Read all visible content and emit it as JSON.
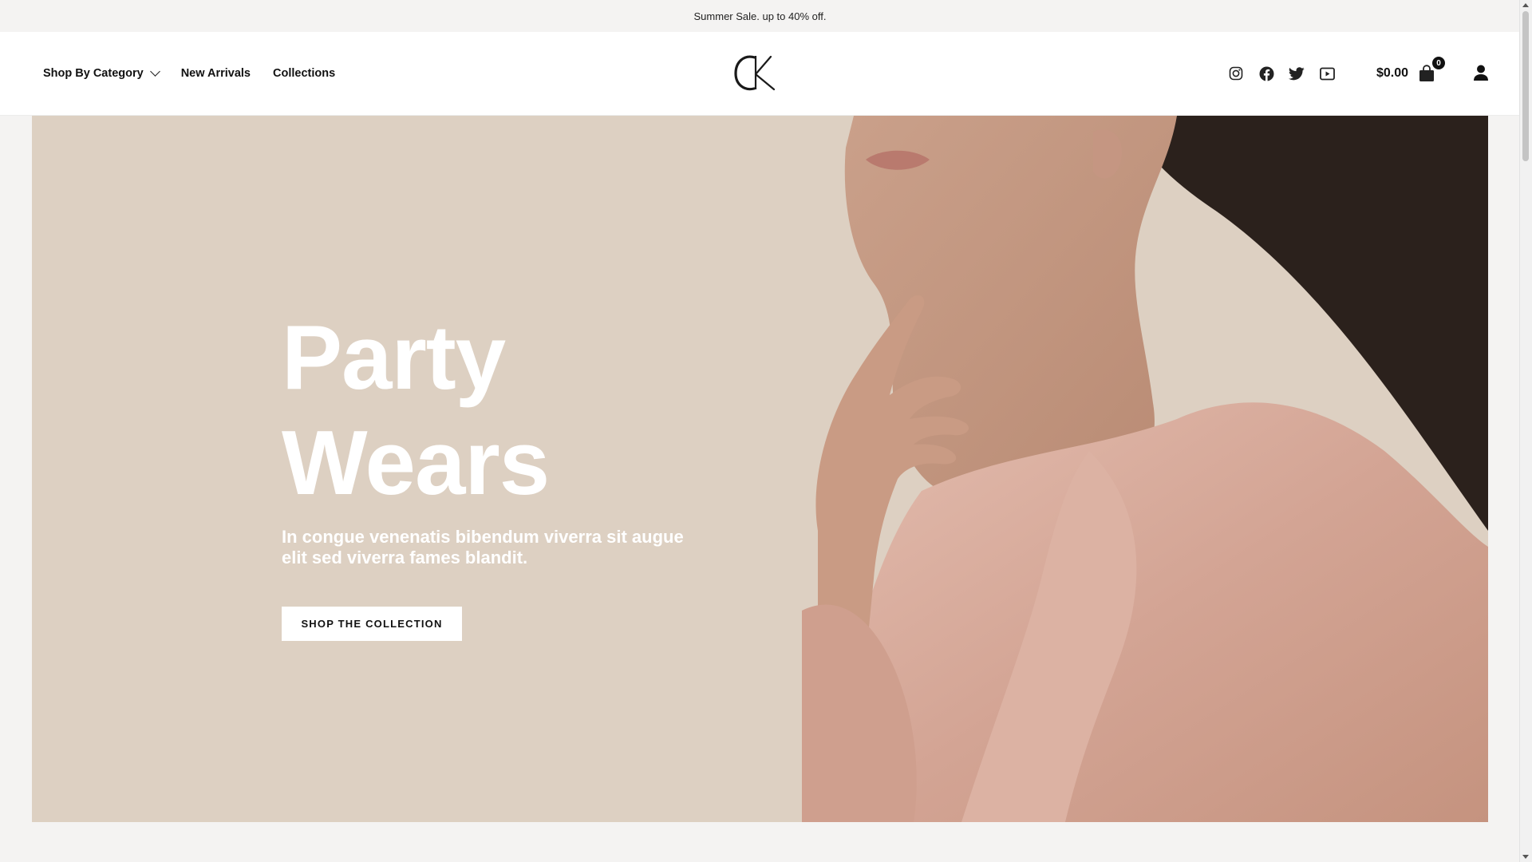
{
  "announcement": {
    "text": "Summer Sale. up to 40% off."
  },
  "nav": {
    "items": [
      {
        "label": "Shop By Category",
        "has_dropdown": true
      },
      {
        "label": "New Arrivals",
        "has_dropdown": false
      },
      {
        "label": "Collections",
        "has_dropdown": false
      }
    ]
  },
  "logo": {
    "text": "CK"
  },
  "social": {
    "icons": [
      "instagram-icon",
      "facebook-icon",
      "twitter-icon",
      "youtube-icon"
    ]
  },
  "cart": {
    "total": "$0.00",
    "count": "0",
    "icon": "shopping-bag-icon"
  },
  "account": {
    "icon": "user-icon"
  },
  "hero": {
    "title_line1": "Party",
    "title_line2": "Wears",
    "subtitle": "In congue venenatis bibendum viverra sit augue elit sed viverra fames blandit.",
    "button_label": "SHOP THE COLLECTION",
    "background_color": "#ddd0c2",
    "image": "woman-in-pink-blouse-portrait"
  },
  "colors": {
    "text": "#111111",
    "announcement_bg": "#f4f3f2",
    "button_bg": "#ffffff"
  }
}
